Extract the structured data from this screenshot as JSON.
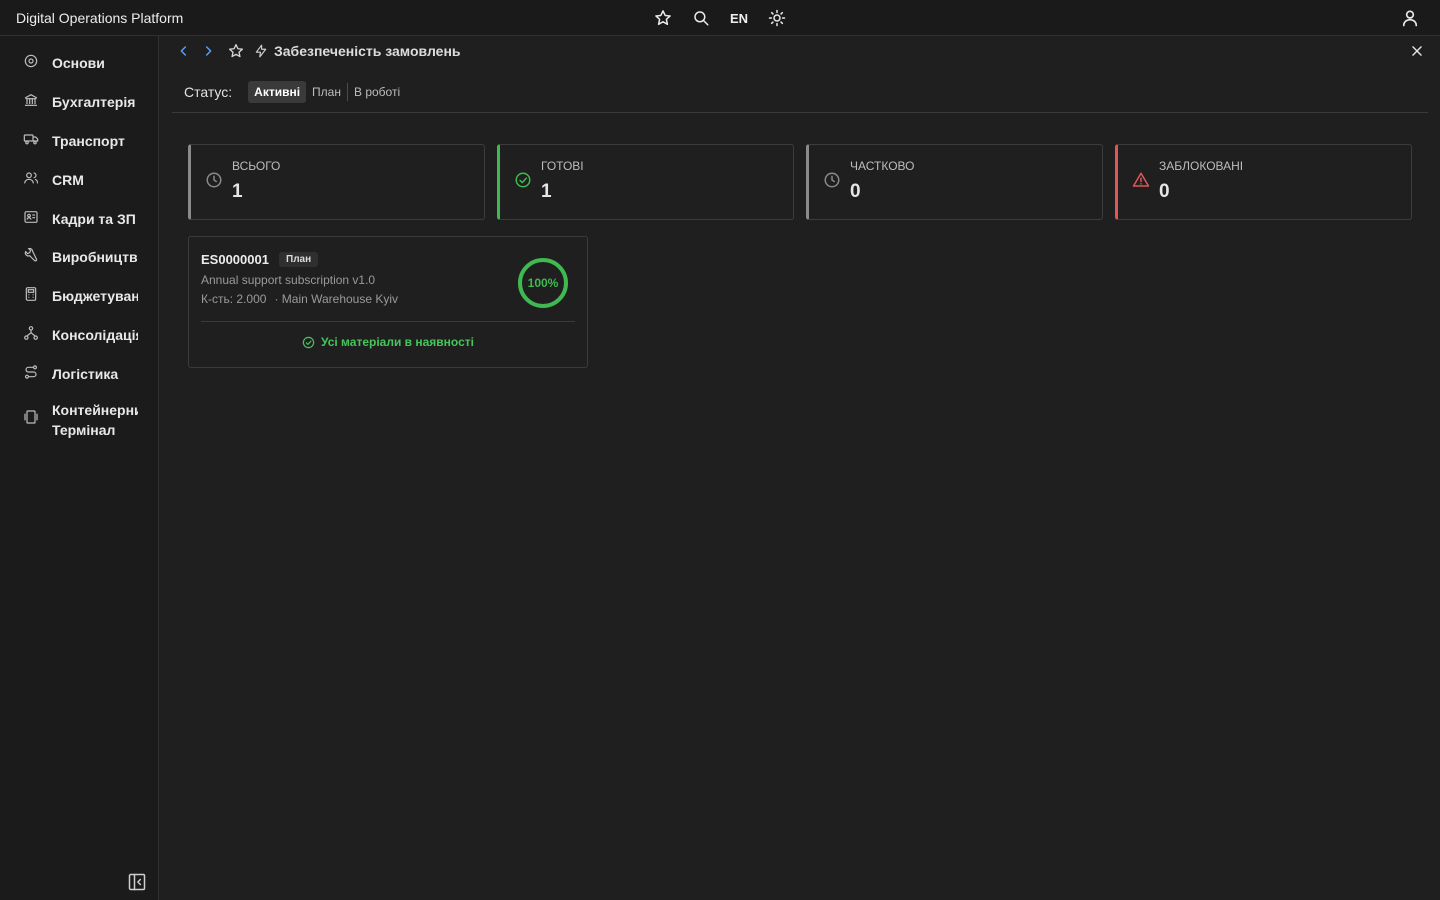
{
  "app": {
    "title": "Digital Operations Platform"
  },
  "topbar": {
    "icons": [
      "star-icon",
      "search-icon",
      "sun-icon",
      "user-icon"
    ],
    "language": "EN"
  },
  "sidebar": {
    "items": [
      {
        "label": "Основи",
        "icon": "gear-icon"
      },
      {
        "label": "Бухгалтерія",
        "icon": "bank-icon"
      },
      {
        "label": "Транспорт",
        "icon": "truck-icon"
      },
      {
        "label": "CRM",
        "icon": "users-icon"
      },
      {
        "label": "Кадри та ЗП",
        "icon": "id-card-icon"
      },
      {
        "label": "Виробництво",
        "icon": "wrench-icon"
      },
      {
        "label": "Бюджетування",
        "icon": "calculator-icon"
      },
      {
        "label": "Консолідація",
        "icon": "network-icon"
      },
      {
        "label": "Логістика",
        "icon": "route-icon"
      },
      {
        "label": "Контейнерний Термінал",
        "icon": "container-icon"
      }
    ]
  },
  "page": {
    "title": "Забезпеченість замовлень"
  },
  "status_filter": {
    "label": "Статус:",
    "options": [
      "Активні",
      "План",
      "В роботі"
    ],
    "selected": "Активні"
  },
  "stats": [
    {
      "label": "ВСЬОГО",
      "value": "1",
      "icon": "clock-icon",
      "color": "#8a8a8a"
    },
    {
      "label": "ГОТОВІ",
      "value": "1",
      "icon": "check-circle-icon",
      "color": "#3fb950"
    },
    {
      "label": "ЧАСТКОВО",
      "value": "0",
      "icon": "clock-icon",
      "color": "#8a8a8a"
    },
    {
      "label": "ЗАБЛОКОВАНІ",
      "value": "0",
      "icon": "warning-icon",
      "color": "#e05656"
    }
  ],
  "orders": [
    {
      "code": "ES0000001",
      "badge": "План",
      "description": "Annual support subscription v1.0",
      "qty": "К-сть: 2.000",
      "warehouse": "· Main Warehouse Kyiv",
      "progress_pct": 100,
      "progress_label": "100%",
      "status_text": "Усі матеріали в наявності"
    }
  ],
  "colors": {
    "accent_green": "#3fb950",
    "accent_red": "#e05656",
    "nav_blue": "#5aa0ff"
  }
}
